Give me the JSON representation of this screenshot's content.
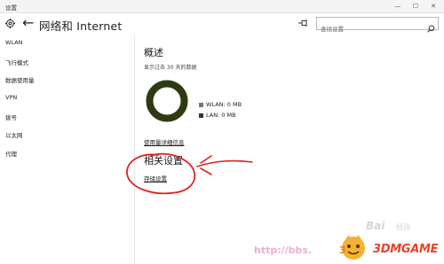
{
  "window": {
    "title": "设置",
    "controls": [
      "—",
      "☐",
      "✕"
    ]
  },
  "header": {
    "back_icon": "back-arrow-icon",
    "home_icon": "gear-icon",
    "title": "网络和 Internet",
    "pin_icon": "pin-icon",
    "search": {
      "placeholder": "查找设置",
      "icon": "search-icon"
    }
  },
  "sidebar": {
    "items": [
      {
        "label": "WLAN"
      },
      {
        "label": "飞行模式"
      },
      {
        "label": "数据使用量"
      },
      {
        "label": "VPN"
      },
      {
        "label": "拨号"
      },
      {
        "label": "以太网"
      },
      {
        "label": "代理"
      }
    ]
  },
  "main": {
    "overview_heading": "概述",
    "usage_subtitle": "显示过去 30 天的数据",
    "legend": [
      {
        "label": "WLAN: 0 MB",
        "color": "#777777"
      },
      {
        "label": "LAN: 0 MB",
        "color": "#333333"
      }
    ],
    "donut_color": "#2e3a12",
    "usage_details_link": "使用量详细信息",
    "related_heading": "相关设置",
    "storage_link": "存储设置"
  },
  "annotation": {
    "color": "#e02020"
  },
  "watermark": {
    "url": "http://bbs.",
    "num": "3",
    "brand": "3DMGAME",
    "baidu": "Bai",
    "baidu_cn": "经验"
  }
}
